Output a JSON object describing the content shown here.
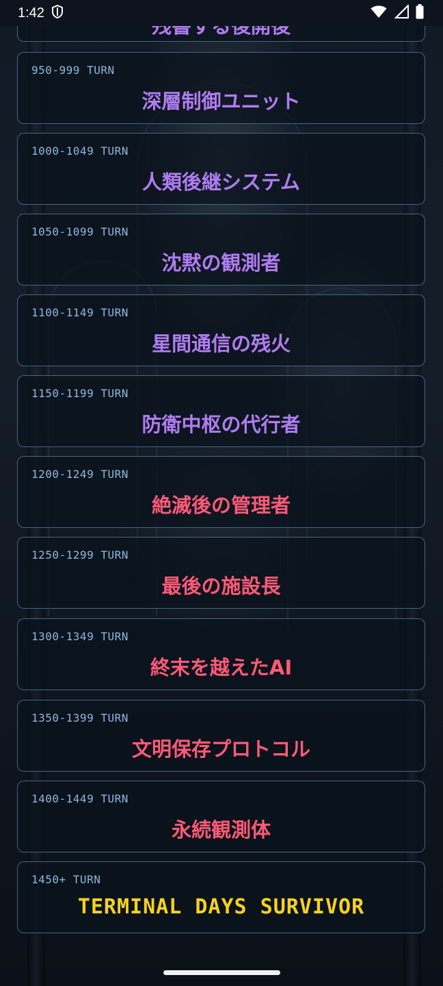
{
  "status_bar": {
    "time": "1:42",
    "icons": [
      "shield-icon",
      "wifi-icon",
      "signal-icon",
      "battery-icon"
    ]
  },
  "colors": {
    "purple_title": "#b07cf2",
    "pink_title": "#ff5a78",
    "gold_title": "#f7d21e",
    "turn_text": "#8fb8e0",
    "card_border": "#5684b0"
  },
  "partial_card": {
    "title": "残書する後開後",
    "color": "#b07cf2"
  },
  "cards": [
    {
      "turn": "950-999 TURN",
      "title": "深層制御ユニット",
      "color": "#b07cf2"
    },
    {
      "turn": "1000-1049 TURN",
      "title": "人類後継システム",
      "color": "#b07cf2"
    },
    {
      "turn": "1050-1099 TURN",
      "title": "沈黙の観測者",
      "color": "#b07cf2"
    },
    {
      "turn": "1100-1149 TURN",
      "title": "星間通信の残火",
      "color": "#b07cf2"
    },
    {
      "turn": "1150-1199 TURN",
      "title": "防衛中枢の代行者",
      "color": "#b07cf2"
    },
    {
      "turn": "1200-1249 TURN",
      "title": "絶滅後の管理者",
      "color": "#ff5a78"
    },
    {
      "turn": "1250-1299 TURN",
      "title": "最後の施設長",
      "color": "#ff5a78"
    },
    {
      "turn": "1300-1349 TURN",
      "title": "終末を越えたAI",
      "color": "#ff5a78"
    },
    {
      "turn": "1350-1399 TURN",
      "title": "文明保存プロトコル",
      "color": "#ff5a78"
    },
    {
      "turn": "1400-1449 TURN",
      "title": "永続観測体",
      "color": "#ff5a78"
    },
    {
      "turn": "1450+ TURN",
      "title": "TERMINAL DAYS SURVIVOR",
      "color": "#f7d21e"
    }
  ]
}
